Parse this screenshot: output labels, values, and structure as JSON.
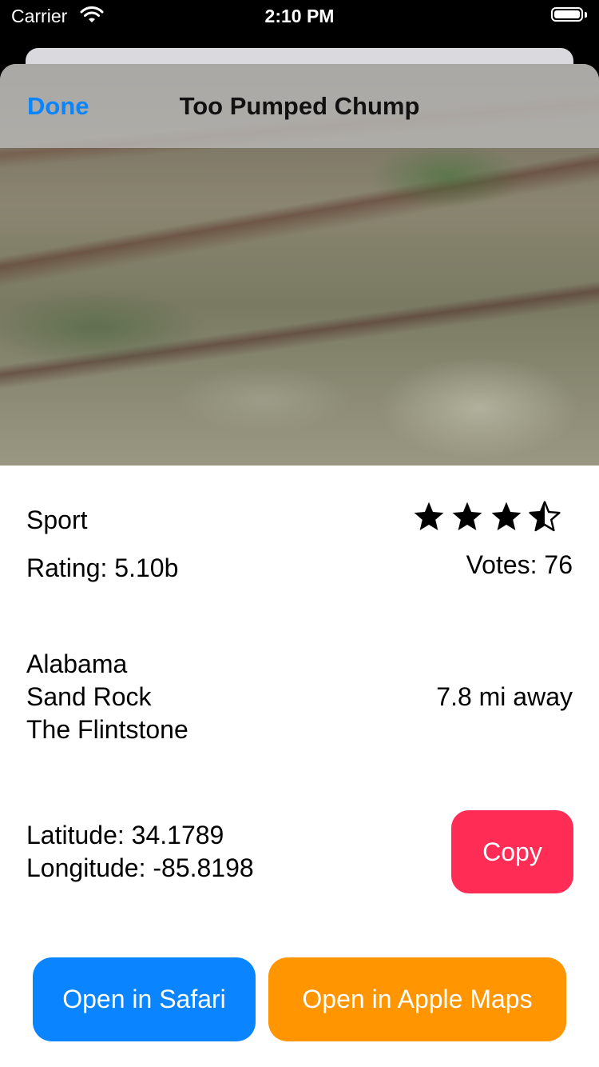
{
  "status_bar": {
    "carrier": "Carrier",
    "time": "2:10 PM"
  },
  "nav": {
    "done_label": "Done",
    "title": "Too Pumped Chump"
  },
  "route": {
    "type": "Sport",
    "rating": "Rating: 5.10b",
    "votes": "Votes: 76",
    "stars": 3.5,
    "location_lines": [
      "Alabama",
      "Sand Rock",
      "The Flintstone"
    ],
    "distance": "7.8 mi away",
    "latitude": "Latitude: 34.1789",
    "longitude": "Longitude: -85.8198"
  },
  "buttons": {
    "copy": "Copy",
    "safari": "Open in Safari",
    "maps": "Open in Apple Maps"
  },
  "colors": {
    "done": "#0a84ff",
    "copy": "#ff2d55",
    "safari": "#0a84ff",
    "maps": "#ff9500"
  }
}
